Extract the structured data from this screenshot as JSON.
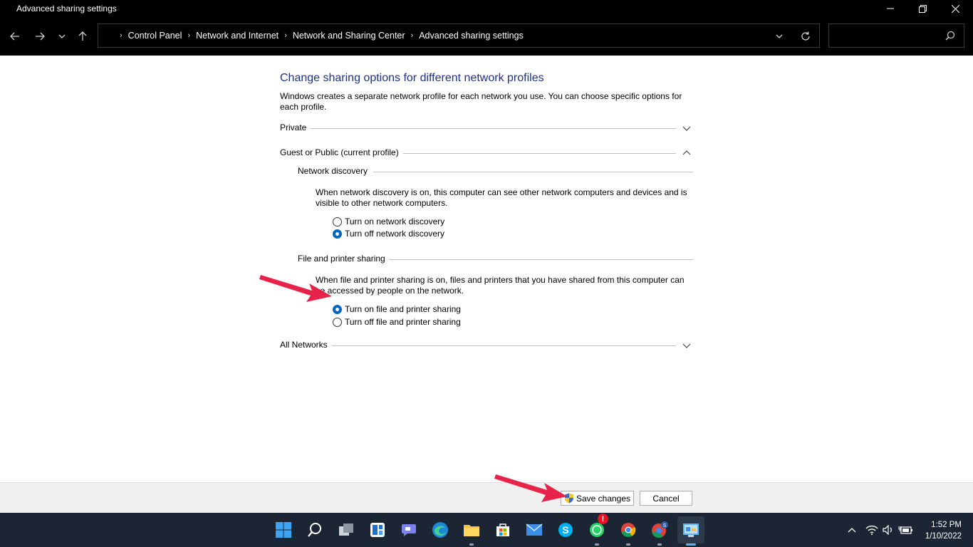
{
  "window": {
    "title": "Advanced sharing settings"
  },
  "address": {
    "breadcrumbs": [
      "Control Panel",
      "Network and Internet",
      "Network and Sharing Center",
      "Advanced sharing settings"
    ],
    "search_placeholder": ""
  },
  "page": {
    "heading": "Change sharing options for different network profiles",
    "intro": "Windows creates a separate network profile for each network you use. You can choose specific options for each profile.",
    "profiles": {
      "private": {
        "label": "Private",
        "expanded": false
      },
      "guest_public": {
        "label": "Guest or Public (current profile)",
        "expanded": true
      },
      "all_networks": {
        "label": "All Networks",
        "expanded": false
      }
    },
    "network_discovery": {
      "title": "Network discovery",
      "description": "When network discovery is on, this computer can see other network computers and devices and is visible to other network computers.",
      "option_on": "Turn on network discovery",
      "option_off": "Turn off network discovery",
      "selected": "off"
    },
    "file_printer_sharing": {
      "title": "File and printer sharing",
      "description": "When file and printer sharing is on, files and printers that you have shared from this computer can be accessed by people on the network.",
      "option_on": "Turn on file and printer sharing",
      "option_off": "Turn off file and printer sharing",
      "selected": "on"
    }
  },
  "buttons": {
    "save": "Save changes",
    "cancel": "Cancel"
  },
  "taskbar": {
    "apps": [
      "windows-start",
      "search",
      "task-view",
      "widgets",
      "teams-chat",
      "edge",
      "file-explorer",
      "microsoft-store",
      "mail",
      "skype",
      "whatsapp",
      "chrome",
      "chrome-profile",
      "control-panel"
    ],
    "whatsapp_badge": "!",
    "time": "1:52 PM",
    "date": "1/10/2022"
  },
  "colors": {
    "heading": "#1e3287",
    "accent": "#0067c0",
    "annotation_arrow": "#e8234a",
    "taskbar": "#1b2533"
  }
}
